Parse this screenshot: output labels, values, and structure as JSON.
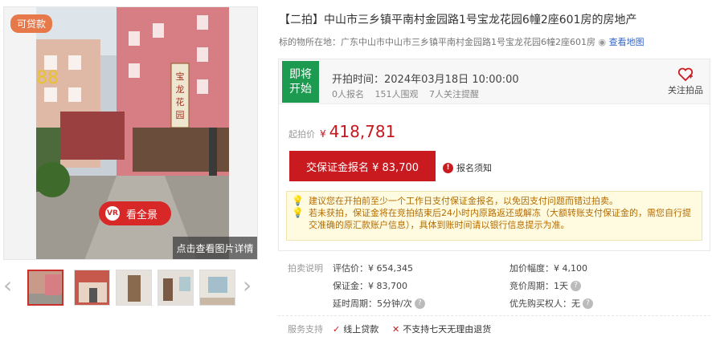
{
  "listing": {
    "title": "【二拍】中山市三乡镇平南村金园路1号宝龙花园6幢2座601房的房地产",
    "address_label": "标的物所在地：",
    "address": "广东中山市中山市三乡镇平南村金园路1号宝龙花园6幢2座601房",
    "map_link": "查看地图"
  },
  "gallery": {
    "loan_badge": "可贷款",
    "vr_button": "看全景",
    "vr_icon_text": "VR",
    "detail_link": "点击查看图片详情",
    "sign_text": "宝龙花园",
    "thumbnails": 5
  },
  "auction": {
    "status": [
      "即将",
      "开始"
    ],
    "start_time_label": "开拍时间：",
    "start_time": "2024年03月18日 10:00:00",
    "stats": [
      "0人报名",
      "151人围观",
      "7人关注提醒"
    ],
    "follow_label": "关注拍品",
    "price_label": "起拍价",
    "price_currency": "¥",
    "price": "418,781",
    "deposit_button": "交保证金报名 ¥ 83,700",
    "notice": "报名须知",
    "tips": [
      "建议您在开拍前至少一个工作日支付保证金报名，以免因支付问题而错过拍卖。",
      "若未获拍，保证金将在竞拍结束后24小时内原路返还或解冻（大额转账支付保证金的，需您自行提交准确的原汇款账户信息），具体到账时间请以银行信息提示为准。"
    ]
  },
  "info": {
    "label": "拍卖说明",
    "assessment": "评估价：¥ 654,345",
    "increment": "加价幅度：¥ 4,100",
    "deposit": "保证金：¥ 83,700",
    "bid_cycle": "竞价周期：1天",
    "delay_cycle": "延时周期：5分钟/次",
    "priority": "优先购买权人：无"
  },
  "services": {
    "label": "服务支持",
    "online_loan": "线上贷款",
    "no_return": "不支持七天无理由退货"
  },
  "colors": {
    "accent": "#c81a1f",
    "status_green": "#1c9a4f"
  }
}
